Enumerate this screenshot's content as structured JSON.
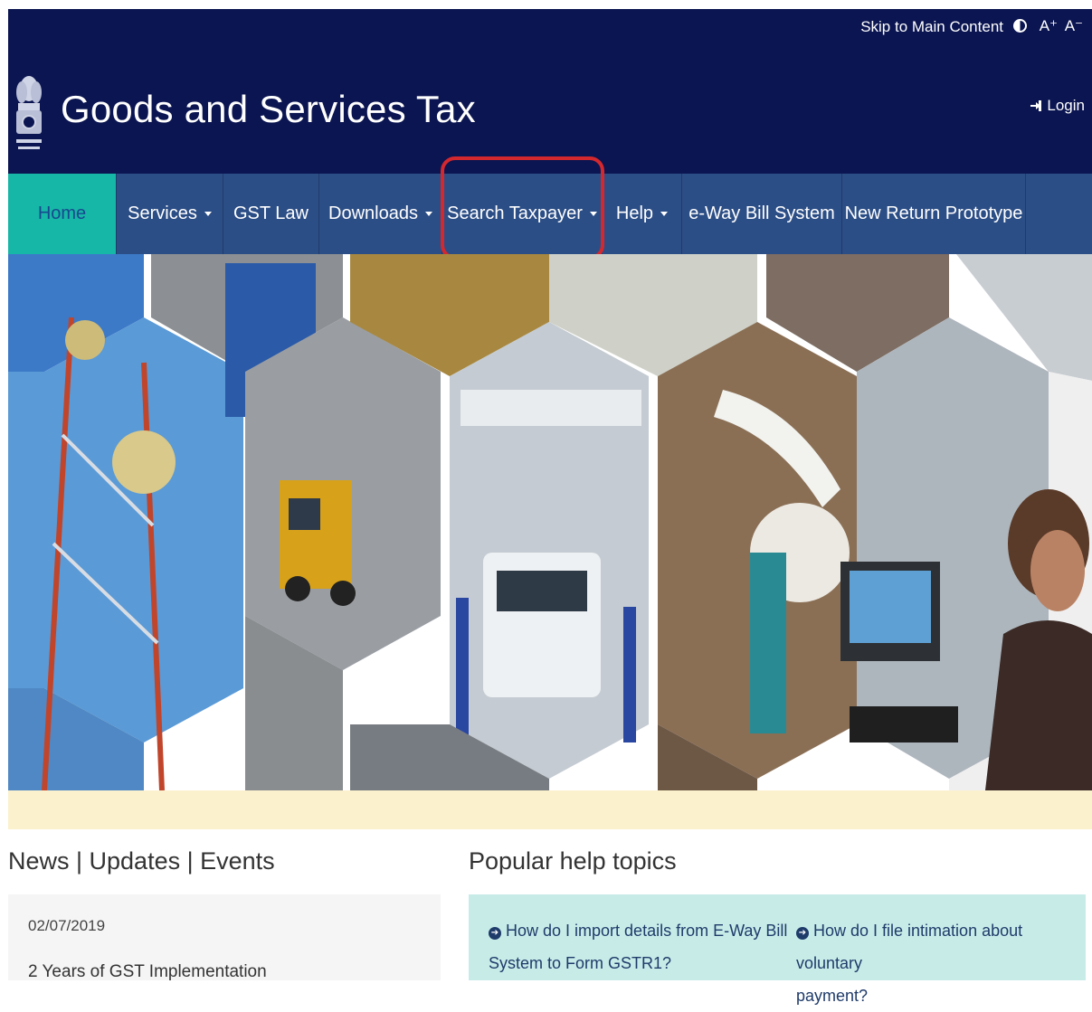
{
  "accessibility": {
    "skip_label": "Skip to Main Content",
    "contrast_icon": "contrast-icon",
    "increase_font": "A⁺",
    "decrease_font": "A⁻"
  },
  "header": {
    "title": "Goods and Services Tax",
    "login_label": "Login",
    "emblem": "india-emblem"
  },
  "nav": {
    "items": [
      {
        "label": "Home"
      },
      {
        "label": "Services"
      },
      {
        "label": "GST Law"
      },
      {
        "label": "Downloads"
      },
      {
        "label": "Search Taxpayer"
      },
      {
        "label": "Help"
      },
      {
        "label": "e-Way Bill System"
      },
      {
        "label": "New Return Prototype"
      }
    ]
  },
  "news": {
    "title": "News | Updates | Events",
    "date": "02/07/2019",
    "headline": "2 Years of GST Implementation"
  },
  "help": {
    "title": "Popular help topics",
    "topics": [
      {
        "line1": "How do I import details from E-Way Bill",
        "line2": "System to Form GSTR1?"
      },
      {
        "line1": "How do I file intimation about voluntary",
        "line2": "payment?"
      }
    ]
  },
  "colors": {
    "header_bg": "#0b1551",
    "nav_bg": "#2c4e86",
    "nav_active": "#17b7a7",
    "highlight": "#d4282f",
    "strip": "#fbf1cd",
    "help_bg": "#c7ece8"
  }
}
